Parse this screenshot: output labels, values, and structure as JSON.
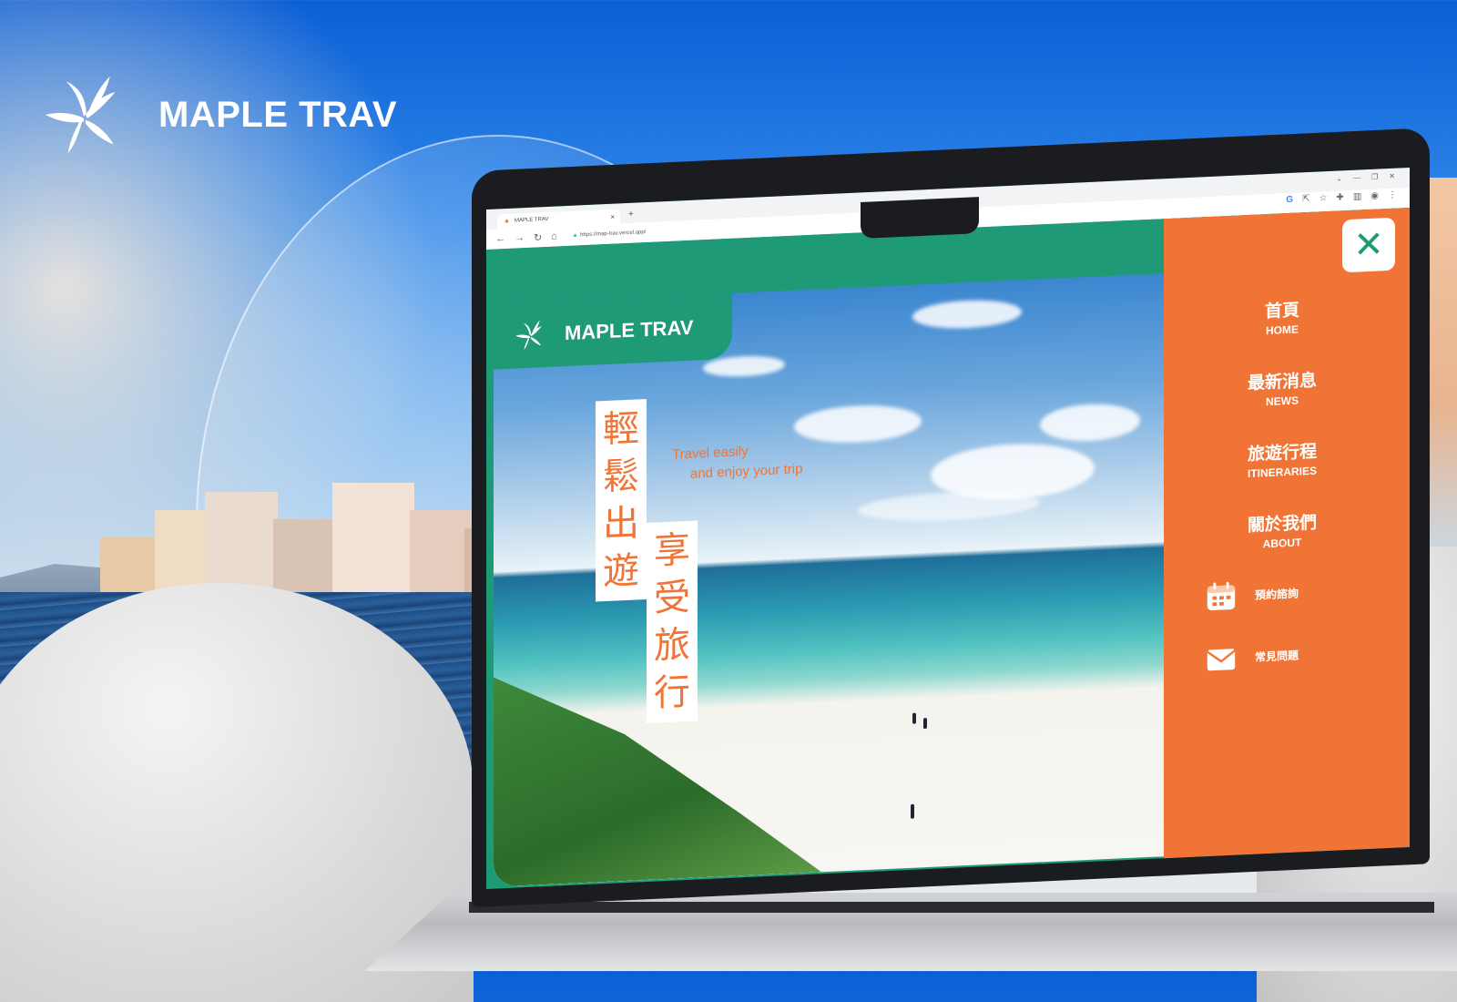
{
  "brand": {
    "name": "MAPLE TRAV"
  },
  "browser": {
    "tab_title": "MAPLE TRAV",
    "tab_close": "×",
    "new_tab": "+",
    "url": "https://map-trav.vercel.app/",
    "window_controls": [
      "⌄",
      "—",
      "❐",
      "✕"
    ]
  },
  "site": {
    "logo_name": "MAPLE TRAV",
    "hero": {
      "column1": [
        "輕",
        "鬆",
        "出",
        "遊"
      ],
      "column2": [
        "享",
        "受",
        "旅",
        "行"
      ],
      "tagline_line1": "Travel easily",
      "tagline_line2": "and enjoy your trip"
    },
    "menu": {
      "close_label": "✕",
      "items": [
        {
          "zh": "首頁",
          "en": "HOME"
        },
        {
          "zh": "最新消息",
          "en": "NEWS"
        },
        {
          "zh": "旅遊行程",
          "en": "ITINERARIES"
        },
        {
          "zh": "關於我們",
          "en": "ABOUT"
        }
      ],
      "actions": [
        {
          "label": "預約諮詢",
          "icon": "calendar-icon"
        },
        {
          "label": "常見問題",
          "icon": "mail-icon"
        }
      ]
    }
  },
  "colors": {
    "brand_green": "#1f9a77",
    "brand_orange": "#f07435"
  }
}
